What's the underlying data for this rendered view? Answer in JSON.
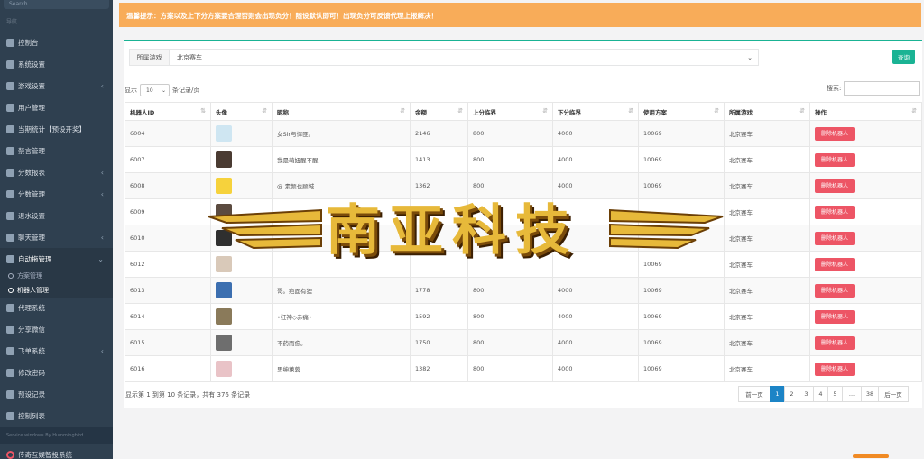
{
  "sidebar": {
    "search_placeholder": "Search...",
    "nav_title": "导航",
    "items": [
      {
        "label": "控制台",
        "has_arrow": false
      },
      {
        "label": "系统设置",
        "has_arrow": false
      },
      {
        "label": "游戏设置",
        "has_arrow": true
      },
      {
        "label": "用户管理",
        "has_arrow": false
      },
      {
        "label": "当期统计【预设开奖】",
        "has_arrow": false
      },
      {
        "label": "禁言管理",
        "has_arrow": false
      },
      {
        "label": "分数报表",
        "has_arrow": true
      },
      {
        "label": "分数管理",
        "has_arrow": true
      },
      {
        "label": "退水设置",
        "has_arrow": false
      },
      {
        "label": "聊天管理",
        "has_arrow": true
      },
      {
        "label": "自动拖管理",
        "has_arrow": true
      }
    ],
    "sub_items": [
      {
        "label": "方案管理"
      },
      {
        "label": "机器人管理"
      }
    ],
    "items_after": [
      {
        "label": "代理系统",
        "has_arrow": false
      },
      {
        "label": "分享微信",
        "has_arrow": false
      },
      {
        "label": "飞单系统",
        "has_arrow": true
      },
      {
        "label": "修改密码",
        "has_arrow": false
      },
      {
        "label": "预设记录",
        "has_arrow": false
      },
      {
        "label": "控制列表",
        "has_arrow": false
      }
    ],
    "footer": "Service windows By Hummingbird",
    "last_item": "传奇互娱智投系统"
  },
  "alert": {
    "label": "温馨提示：",
    "text": "方案以及上下分方案要合理否则会出现负分！随设默认即可！出现负分可反馈代理上报解决！"
  },
  "filter": {
    "label": "所属游戏",
    "value": "北京赛车",
    "button": "查询"
  },
  "length": {
    "prefix": "显示",
    "value": "10",
    "suffix": "条记录/页"
  },
  "search_label": "搜索:",
  "columns": [
    "机器人ID",
    "头像",
    "昵称",
    "余额",
    "上分临界",
    "下分临界",
    "使用方案",
    "所属游戏",
    "操作"
  ],
  "rows": [
    {
      "id": "6004",
      "nickname": "女Sir与悍匪。",
      "balance": "2146",
      "up": "800",
      "down": "4000",
      "plan": "10069",
      "game": "北京赛车",
      "action": "删除机器人",
      "avatar_color": "#cfe6f2"
    },
    {
      "id": "6007",
      "nickname": "我是萌妞醒不醒i",
      "balance": "1413",
      "up": "800",
      "down": "4000",
      "plan": "10069",
      "game": "北京赛车",
      "action": "删除机器人",
      "avatar_color": "#4a3b32"
    },
    {
      "id": "6008",
      "nickname": "@.素颜也顾城",
      "balance": "1362",
      "up": "800",
      "down": "4000",
      "plan": "10069",
      "game": "北京赛车",
      "action": "删除机器人",
      "avatar_color": "#f6d23c"
    },
    {
      "id": "6009",
      "nickname": "",
      "balance": "",
      "up": "",
      "down": "",
      "plan": "",
      "game": "北京赛车",
      "action": "删除机器人",
      "avatar_color": "#5b4b40"
    },
    {
      "id": "6010",
      "nickname": "",
      "balance": "",
      "up": "",
      "down": "",
      "plan": "",
      "game": "北京赛车",
      "action": "删除机器人",
      "avatar_color": "#2f2f2f"
    },
    {
      "id": "6012",
      "nickname": "",
      "balance": "",
      "up": "",
      "down": "",
      "plan": "10069",
      "game": "北京赛车",
      "action": "删除机器人",
      "avatar_color": "#d9c9b9"
    },
    {
      "id": "6013",
      "nickname": "哥。疤面有狸",
      "balance": "1778",
      "up": "800",
      "down": "4000",
      "plan": "10069",
      "game": "北京赛车",
      "action": "删除机器人",
      "avatar_color": "#3c6fb0"
    },
    {
      "id": "6014",
      "nickname": "•狂神◇赤痛•",
      "balance": "1592",
      "up": "800",
      "down": "4000",
      "plan": "10069",
      "game": "北京赛车",
      "action": "删除机器人",
      "avatar_color": "#8a7a5a"
    },
    {
      "id": "6015",
      "nickname": "不药而愈。",
      "balance": "1750",
      "up": "800",
      "down": "4000",
      "plan": "10069",
      "game": "北京赛车",
      "action": "删除机器人",
      "avatar_color": "#6e6e6e"
    },
    {
      "id": "6016",
      "nickname": "思绅蕙蓉",
      "balance": "1382",
      "up": "800",
      "down": "4000",
      "plan": "10069",
      "game": "北京赛车",
      "action": "删除机器人",
      "avatar_color": "#e9c3c7"
    }
  ],
  "info": "显示第 1 到第 10 条记录，共有 376 条记录",
  "pagination": [
    "前一页",
    "1",
    "2",
    "3",
    "4",
    "5",
    "...",
    "38",
    "后一页"
  ],
  "watermark": "南亚科技"
}
